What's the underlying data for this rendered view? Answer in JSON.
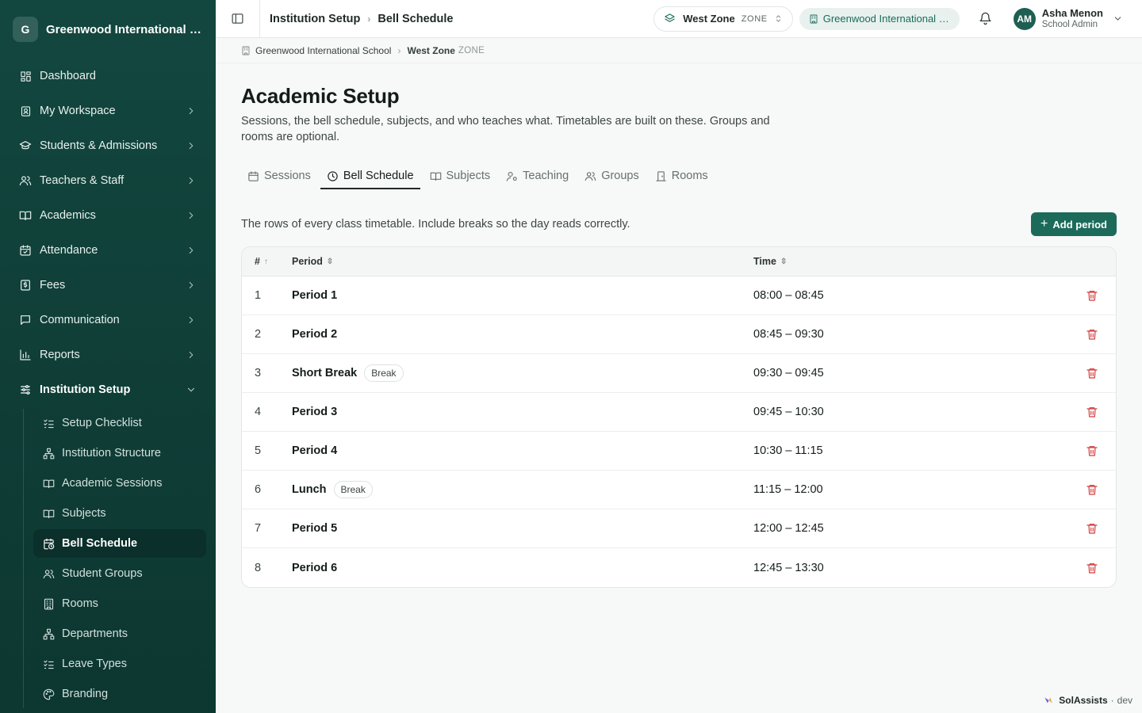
{
  "sidebar": {
    "brand_initial": "G",
    "brand_name": "Greenwood International School",
    "items": [
      {
        "label": "Dashboard"
      },
      {
        "label": "My Workspace"
      },
      {
        "label": "Students & Admissions"
      },
      {
        "label": "Teachers & Staff"
      },
      {
        "label": "Academics"
      },
      {
        "label": "Attendance"
      },
      {
        "label": "Fees"
      },
      {
        "label": "Communication"
      },
      {
        "label": "Reports"
      },
      {
        "label": "Institution Setup"
      }
    ],
    "sub_items": [
      {
        "label": "Setup Checklist"
      },
      {
        "label": "Institution Structure"
      },
      {
        "label": "Academic Sessions"
      },
      {
        "label": "Subjects"
      },
      {
        "label": "Bell Schedule"
      },
      {
        "label": "Student Groups"
      },
      {
        "label": "Rooms"
      },
      {
        "label": "Departments"
      },
      {
        "label": "Leave Types"
      },
      {
        "label": "Branding"
      }
    ]
  },
  "topbar": {
    "crumb_parent": "Institution Setup",
    "crumb_current": "Bell Schedule",
    "zone_name": "West Zone",
    "zone_tag": "ZONE",
    "school_name": "Greenwood International School",
    "user_initials": "AM",
    "user_name": "Asha Menon",
    "user_role": "School Admin"
  },
  "subcrumb": {
    "school": "Greenwood International School",
    "zone": "West Zone",
    "zone_tag": "ZONE"
  },
  "page": {
    "title": "Academic Setup",
    "description": "Sessions, the bell schedule, subjects, and who teaches what. Timetables are built on these. Groups and rooms are optional.",
    "tabs": [
      {
        "label": "Sessions"
      },
      {
        "label": "Bell Schedule"
      },
      {
        "label": "Subjects"
      },
      {
        "label": "Teaching"
      },
      {
        "label": "Groups"
      },
      {
        "label": "Rooms"
      }
    ],
    "hint": "The rows of every class timetable. Include breaks so the day reads correctly.",
    "add_button": "Add period"
  },
  "table": {
    "columns": {
      "num": "#",
      "period": "Period",
      "time": "Time"
    },
    "rows": [
      {
        "num": "1",
        "name": "Period 1",
        "time": "08:00 – 08:45"
      },
      {
        "num": "2",
        "name": "Period 2",
        "time": "08:45 – 09:30"
      },
      {
        "num": "3",
        "name": "Short Break",
        "badge": "Break",
        "time": "09:30 – 09:45"
      },
      {
        "num": "4",
        "name": "Period 3",
        "time": "09:45 – 10:30"
      },
      {
        "num": "5",
        "name": "Period 4",
        "time": "10:30 – 11:15"
      },
      {
        "num": "6",
        "name": "Lunch",
        "badge": "Break",
        "time": "11:15 – 12:00"
      },
      {
        "num": "7",
        "name": "Period 5",
        "time": "12:00 – 12:45"
      },
      {
        "num": "8",
        "name": "Period 6",
        "time": "12:45 – 13:30"
      }
    ]
  },
  "footer": {
    "product": "SolAssists",
    "env": "dev"
  },
  "colors": {
    "sidebar_bg": "#12473f",
    "accent": "#1c6b5a",
    "danger": "#d43b3b"
  }
}
